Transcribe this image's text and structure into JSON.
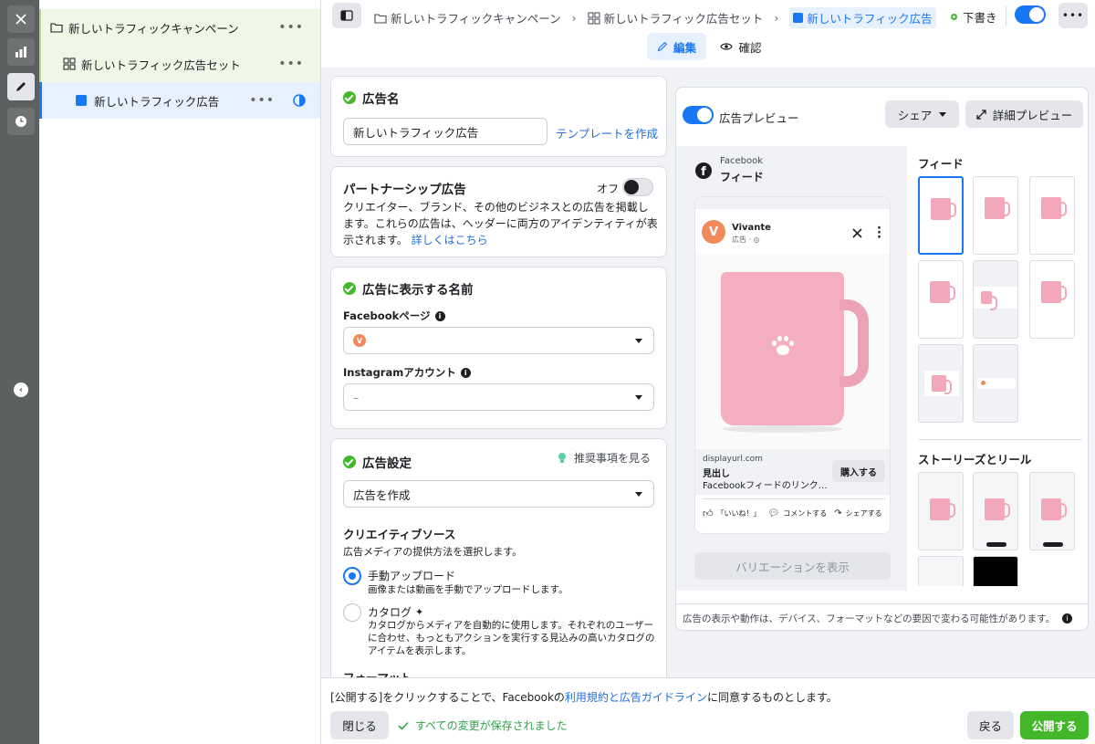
{
  "tree": {
    "campaign": "新しいトラフィックキャンペーン",
    "adset": "新しいトラフィック広告セット",
    "ad": "新しいトラフィック広告",
    "more": "•••"
  },
  "breadcrumb": {
    "campaign": "新しいトラフィックキャンペーン",
    "adset": "新しいトラフィック広告セット",
    "ad": "新しいトラフィック広告",
    "sep": "›"
  },
  "status": {
    "label": "下書き"
  },
  "tabs": {
    "edit": "編集",
    "confirm": "確認"
  },
  "ad_name": {
    "title": "広告名",
    "value": "新しいトラフィック広告",
    "template_link": "テンプレートを作成"
  },
  "partnership": {
    "title": "パートナーシップ広告",
    "toggle_label": "オフ",
    "desc": "クリエイター、ブランド、その他のビジネスとの広告を掲載します。これらの広告は、ヘッダーに両方のアイデンティティが表示されます。",
    "learn_more": "詳しくはこちら"
  },
  "display_name": {
    "title": "広告に表示する名前",
    "fb_label": "Facebookページ",
    "fb_avatar": "V",
    "ig_label": "Instagramアカウント",
    "ig_value": "–"
  },
  "ad_settings": {
    "title": "広告設定",
    "recommend": "推奨事項を見る",
    "select_value": "広告を作成",
    "creative_title": "クリエイティブソース",
    "creative_sub": "広告メディアの提供方法を選択します。",
    "manual_title": "手動アップロード",
    "manual_desc": "画像または動画を手動でアップロードします。",
    "catalog_title": "カタログ",
    "catalog_desc": "カタログからメディアを自動的に使用します。それぞれのユーザーに合わせ、もっともアクションを実行する見込みの高いカタログのアイテムを表示します。",
    "format_title": "フォーマット"
  },
  "preview": {
    "toggle_label": "広告プレビュー",
    "share": "シェア",
    "detail": "詳細プレビュー",
    "platform": "Facebook",
    "placement": "フィード",
    "page_name": "Vivante",
    "page_sub": "広告 · ◎",
    "avatar": "V",
    "url": "displayurl.com",
    "headline": "見出し",
    "desc": "Facebookフィードのリンク…",
    "cta": "購入する",
    "like": "「いいね！」",
    "comment": "コメントする",
    "share_action": "シェアする",
    "variation": "バリエーションを表示",
    "feed_title": "フィード",
    "stories_title": "ストーリーズとリール",
    "footnote": "広告の表示や動作は、デバイス、フォーマットなどの要因で変わる可能性があります。"
  },
  "footer": {
    "agree_pre": "[公開する]をクリックすることで、Facebookの",
    "agree_link": "利用規約と広告ガイドライン",
    "agree_post": "に同意するものとします。",
    "close": "閉じる",
    "saved": "すべての変更が保存されました",
    "back": "戻る",
    "publish": "公開する"
  },
  "colors": {
    "accent": "#1877f2",
    "green": "#42b72a",
    "mug": "#f2a7bb"
  }
}
